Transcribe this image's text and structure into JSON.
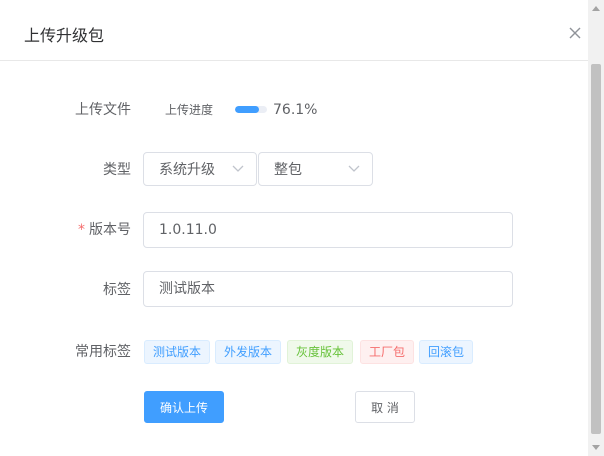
{
  "dialog": {
    "title": "上传升级包"
  },
  "form": {
    "upload": {
      "label": "上传文件",
      "progress_label": "上传进度",
      "progress_percent": 76.1,
      "progress_text": "76.1%"
    },
    "type": {
      "label": "类型",
      "select1_value": "系统升级",
      "select2_value": "整包"
    },
    "version": {
      "required_mark": "*",
      "label": "版本号",
      "value": "1.0.11.0"
    },
    "tag": {
      "label": "标签",
      "placeholder": "测试版本"
    },
    "common_tags": {
      "label": "常用标签",
      "items": [
        {
          "text": "测试版本",
          "color": "#409eff",
          "bg": "#ecf5ff",
          "border": "#d9ecff"
        },
        {
          "text": "外发版本",
          "color": "#409eff",
          "bg": "#ecf5ff",
          "border": "#d9ecff"
        },
        {
          "text": "灰度版本",
          "color": "#67c23a",
          "bg": "#f0f9eb",
          "border": "#e1f3d8"
        },
        {
          "text": "工厂包",
          "color": "#f56c6c",
          "bg": "#fef0f0",
          "border": "#fde2e2"
        },
        {
          "text": "回滚包",
          "color": "#409eff",
          "bg": "#ecf5ff",
          "border": "#d9ecff"
        }
      ]
    }
  },
  "buttons": {
    "confirm": "确认上传",
    "cancel": "取 消"
  },
  "colors": {
    "primary": "#409eff",
    "danger": "#f56c6c",
    "success": "#67c23a"
  },
  "icons": {
    "close": "close-icon",
    "dropdown": "chevron-down-icon"
  }
}
